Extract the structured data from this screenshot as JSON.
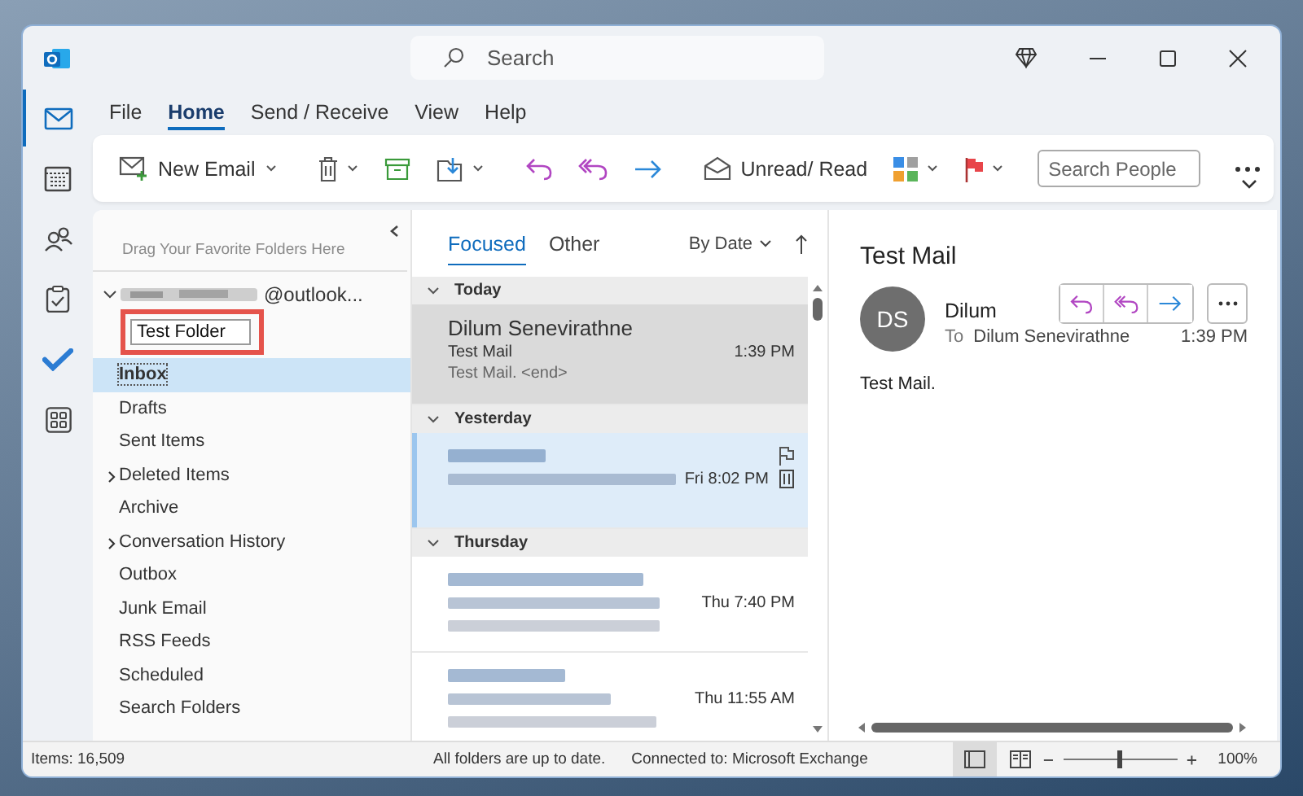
{
  "title_bar": {
    "search_placeholder": "Search"
  },
  "rail": [
    {
      "kind": "mail",
      "selected": true
    },
    {
      "kind": "calendar",
      "selected": false
    },
    {
      "kind": "people",
      "selected": false
    },
    {
      "kind": "tasks",
      "selected": false
    },
    {
      "kind": "todo",
      "selected": false
    },
    {
      "kind": "apps",
      "selected": false
    }
  ],
  "menu_tabs": [
    {
      "label": "File",
      "selected": false
    },
    {
      "label": "Home",
      "selected": true
    },
    {
      "label": "Send / Receive",
      "selected": false
    },
    {
      "label": "View",
      "selected": false
    },
    {
      "label": "Help",
      "selected": false
    }
  ],
  "ribbon": {
    "groups": [
      [
        {
          "kind": "new_email",
          "label": "New Email",
          "dropdown": true
        }
      ],
      [
        {
          "kind": "delete",
          "dropdown": true
        },
        {
          "kind": "archive",
          "dropdown": false
        },
        {
          "kind": "move",
          "dropdown": true
        }
      ],
      [
        {
          "kind": "reply",
          "dropdown": false
        },
        {
          "kind": "reply_all",
          "dropdown": false
        },
        {
          "kind": "forward",
          "dropdown": false
        }
      ],
      [
        {
          "kind": "unread",
          "label": "Unread/ Read",
          "dropdown": false
        },
        {
          "kind": "categorize",
          "dropdown": true
        },
        {
          "kind": "flag",
          "dropdown": true
        }
      ],
      [
        {
          "kind": "search_people",
          "placeholder": "Search People"
        }
      ],
      [
        {
          "kind": "more"
        }
      ]
    ]
  },
  "folder_pane": {
    "favorites_hint": "Drag Your Favorite Folders Here",
    "account": {
      "name": "@outlook...",
      "expanded": true
    },
    "new_folder": {
      "value": "Test Folder",
      "highlighted": true
    },
    "folders": [
      {
        "label": "Inbox",
        "selected": true,
        "expandable": false
      },
      {
        "label": "Drafts",
        "selected": false,
        "expandable": false
      },
      {
        "label": "Sent Items",
        "selected": false,
        "expandable": false
      },
      {
        "label": "Deleted Items",
        "selected": false,
        "expandable": true
      },
      {
        "label": "Archive",
        "selected": false,
        "expandable": false
      },
      {
        "label": "Conversation History",
        "selected": false,
        "expandable": true
      },
      {
        "label": "Outbox",
        "selected": false,
        "expandable": false
      },
      {
        "label": "Junk Email",
        "selected": false,
        "expandable": false
      },
      {
        "label": "RSS Feeds",
        "selected": false,
        "expandable": false
      },
      {
        "label": "Scheduled",
        "selected": false,
        "expandable": false
      },
      {
        "label": "Search Folders",
        "selected": false,
        "expandable": false
      }
    ]
  },
  "message_list": {
    "tabs": [
      {
        "label": "Focused",
        "selected": true
      },
      {
        "label": "Other",
        "selected": false
      }
    ],
    "sort": "By Date",
    "groups": [
      {
        "label": "Today",
        "messages": [
          {
            "kind": "plain",
            "sender": "Dilum Senevirathne",
            "subject": "Test Mail",
            "preview": "Test Mail. <end>",
            "time": "1:39 PM",
            "selected": true,
            "hovered": false
          }
        ]
      },
      {
        "label": "Yesterday",
        "messages": [
          {
            "kind": "blurred",
            "time": "Fri 8:02 PM",
            "selected": false,
            "hovered": true
          }
        ]
      },
      {
        "label": "Thursday",
        "messages": [
          {
            "kind": "blurred",
            "time": "Thu 7:40 PM",
            "selected": false,
            "hovered": false
          },
          {
            "kind": "blurred",
            "time": "Thu 11:55 AM",
            "selected": false,
            "hovered": false
          }
        ]
      }
    ]
  },
  "reading_pane": {
    "subject": "Test Mail",
    "initials": "DS",
    "sender": "Dilum",
    "to_label": "To",
    "to": "Dilum Senevirathne",
    "time": "1:39 PM",
    "body": "Test Mail."
  },
  "status_bar": {
    "items": "Items: 16,509",
    "sync": "All folders are up to date.",
    "connection": "Connected to: Microsoft Exchange",
    "views": [
      {
        "kind": "normal",
        "selected": true
      },
      {
        "kind": "reading",
        "selected": false
      }
    ],
    "zoom": {
      "level": 0.48,
      "label": "100%"
    }
  }
}
